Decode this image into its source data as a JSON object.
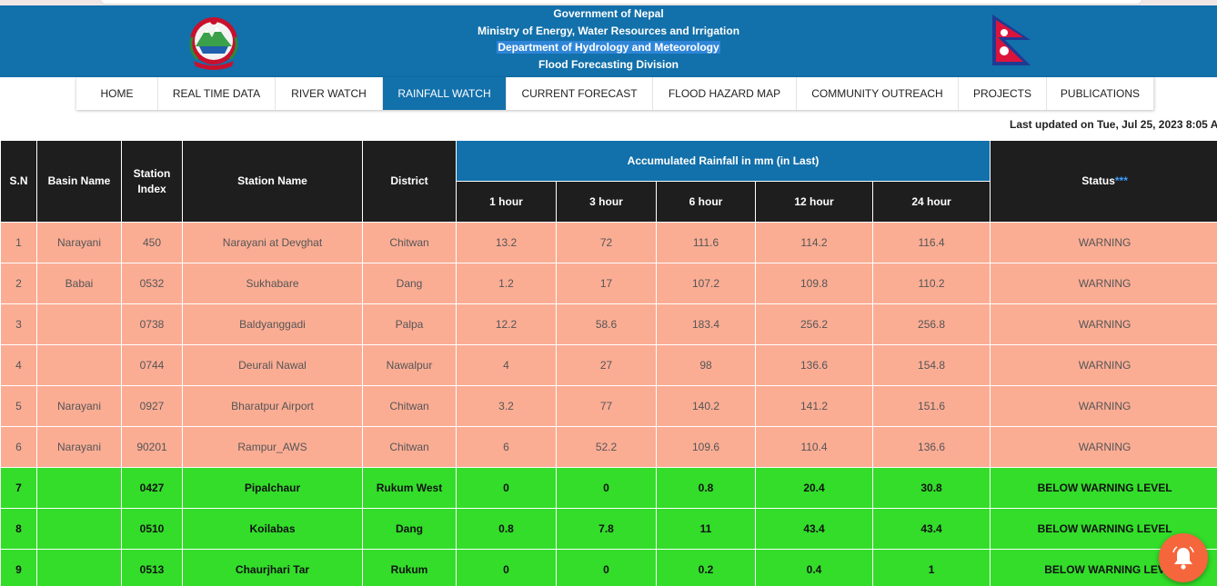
{
  "header": {
    "line1": "Government of Nepal",
    "line2": "Ministry of Energy, Water Resources and Irrigation",
    "line3": "Department of Hydrology and Meteorology",
    "line4": "Flood Forecasting Division",
    "emblem_icon": "nepal-emblem",
    "flag_icon": "nepal-flag"
  },
  "nav": [
    {
      "label": "HOME",
      "active": false
    },
    {
      "label": "REAL TIME DATA",
      "active": false
    },
    {
      "label": "RIVER WATCH",
      "active": false
    },
    {
      "label": "RAINFALL WATCH",
      "active": true
    },
    {
      "label": "CURRENT FORECAST",
      "active": false
    },
    {
      "label": "FLOOD HAZARD MAP",
      "active": false
    },
    {
      "label": "COMMUNITY OUTREACH",
      "active": false
    },
    {
      "label": "PROJECTS",
      "active": false
    },
    {
      "label": "PUBLICATIONS",
      "active": false
    }
  ],
  "last_updated": "Last updated on Tue, Jul 25, 2023 8:05 A",
  "table": {
    "headers": {
      "sn": "S.N",
      "basin": "Basin Name",
      "station_index": "Station Index",
      "station_name": "Station Name",
      "district": "District",
      "accumulated": "Accumulated Rainfall in mm (in Last)",
      "h1": "1 hour",
      "h3": "3 hour",
      "h6": "6 hour",
      "h12": "12 hour",
      "h24": "24 hour",
      "status": "Status",
      "status_marker": "***"
    },
    "rows": [
      {
        "sn": "1",
        "basin": "Narayani",
        "index": "450",
        "name": "Narayani at Devghat",
        "district": "Chitwan",
        "h1": "13.2",
        "h3": "72",
        "h6": "111.6",
        "h12": "114.2",
        "h24": "116.4",
        "status": "WARNING",
        "level": "warn"
      },
      {
        "sn": "2",
        "basin": "Babai",
        "index": "0532",
        "name": "Sukhabare",
        "district": "Dang",
        "h1": "1.2",
        "h3": "17",
        "h6": "107.2",
        "h12": "109.8",
        "h24": "110.2",
        "status": "WARNING",
        "level": "warn"
      },
      {
        "sn": "3",
        "basin": "",
        "index": "0738",
        "name": "Baldyanggadi",
        "district": "Palpa",
        "h1": "12.2",
        "h3": "58.6",
        "h6": "183.4",
        "h12": "256.2",
        "h24": "256.8",
        "status": "WARNING",
        "level": "warn"
      },
      {
        "sn": "4",
        "basin": "",
        "index": "0744",
        "name": "Deurali Nawal",
        "district": "Nawalpur",
        "h1": "4",
        "h3": "27",
        "h6": "98",
        "h12": "136.6",
        "h24": "154.8",
        "status": "WARNING",
        "level": "warn"
      },
      {
        "sn": "5",
        "basin": "Narayani",
        "index": "0927",
        "name": "Bharatpur Airport",
        "district": "Chitwan",
        "h1": "3.2",
        "h3": "77",
        "h6": "140.2",
        "h12": "141.2",
        "h24": "151.6",
        "status": "WARNING",
        "level": "warn"
      },
      {
        "sn": "6",
        "basin": "Narayani",
        "index": "90201",
        "name": "Rampur_AWS",
        "district": "Chitwan",
        "h1": "6",
        "h3": "52.2",
        "h6": "109.6",
        "h12": "110.4",
        "h24": "136.6",
        "status": "WARNING",
        "level": "warn"
      },
      {
        "sn": "7",
        "basin": "",
        "index": "0427",
        "name": "Pipalchaur",
        "district": "Rukum West",
        "h1": "0",
        "h3": "0",
        "h6": "0.8",
        "h12": "20.4",
        "h24": "30.8",
        "status": "BELOW WARNING LEVEL",
        "level": "below"
      },
      {
        "sn": "8",
        "basin": "",
        "index": "0510",
        "name": "Koilabas",
        "district": "Dang",
        "h1": "0.8",
        "h3": "7.8",
        "h6": "11",
        "h12": "43.4",
        "h24": "43.4",
        "status": "BELOW WARNING LEVEL",
        "level": "below"
      },
      {
        "sn": "9",
        "basin": "",
        "index": "0513",
        "name": "Chaurjhari Tar",
        "district": "Rukum",
        "h1": "0",
        "h3": "0",
        "h6": "0.2",
        "h12": "0.4",
        "h24": "1",
        "status": "BELOW WARNING LEV",
        "level": "below"
      }
    ]
  },
  "colors": {
    "header_blue": "#1270aa",
    "warning_row": "#fbad94",
    "below_warning_row": "#33dd2a",
    "table_header": "#1e1e1e",
    "alert_button": "#f5663c"
  },
  "alert_button_icon": "bell-icon"
}
